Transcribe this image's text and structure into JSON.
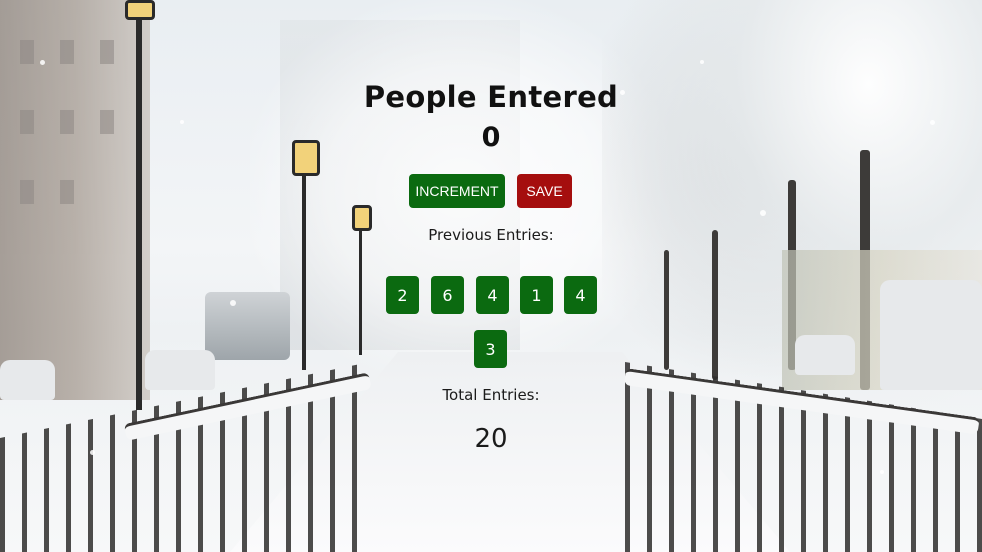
{
  "app": {
    "title": "People Entered",
    "count": "0"
  },
  "buttons": {
    "increment_label": "INCREMENT",
    "save_label": "SAVE"
  },
  "previous_entries": {
    "label": "Previous Entries:",
    "items": [
      "2",
      "6",
      "4",
      "1",
      "4",
      "3"
    ]
  },
  "total": {
    "label": "Total Entries:",
    "value": "20"
  },
  "colors": {
    "increment_bg": "#0b6a10",
    "save_bg": "#a50e0e",
    "entry_bg": "#0b6a10"
  }
}
